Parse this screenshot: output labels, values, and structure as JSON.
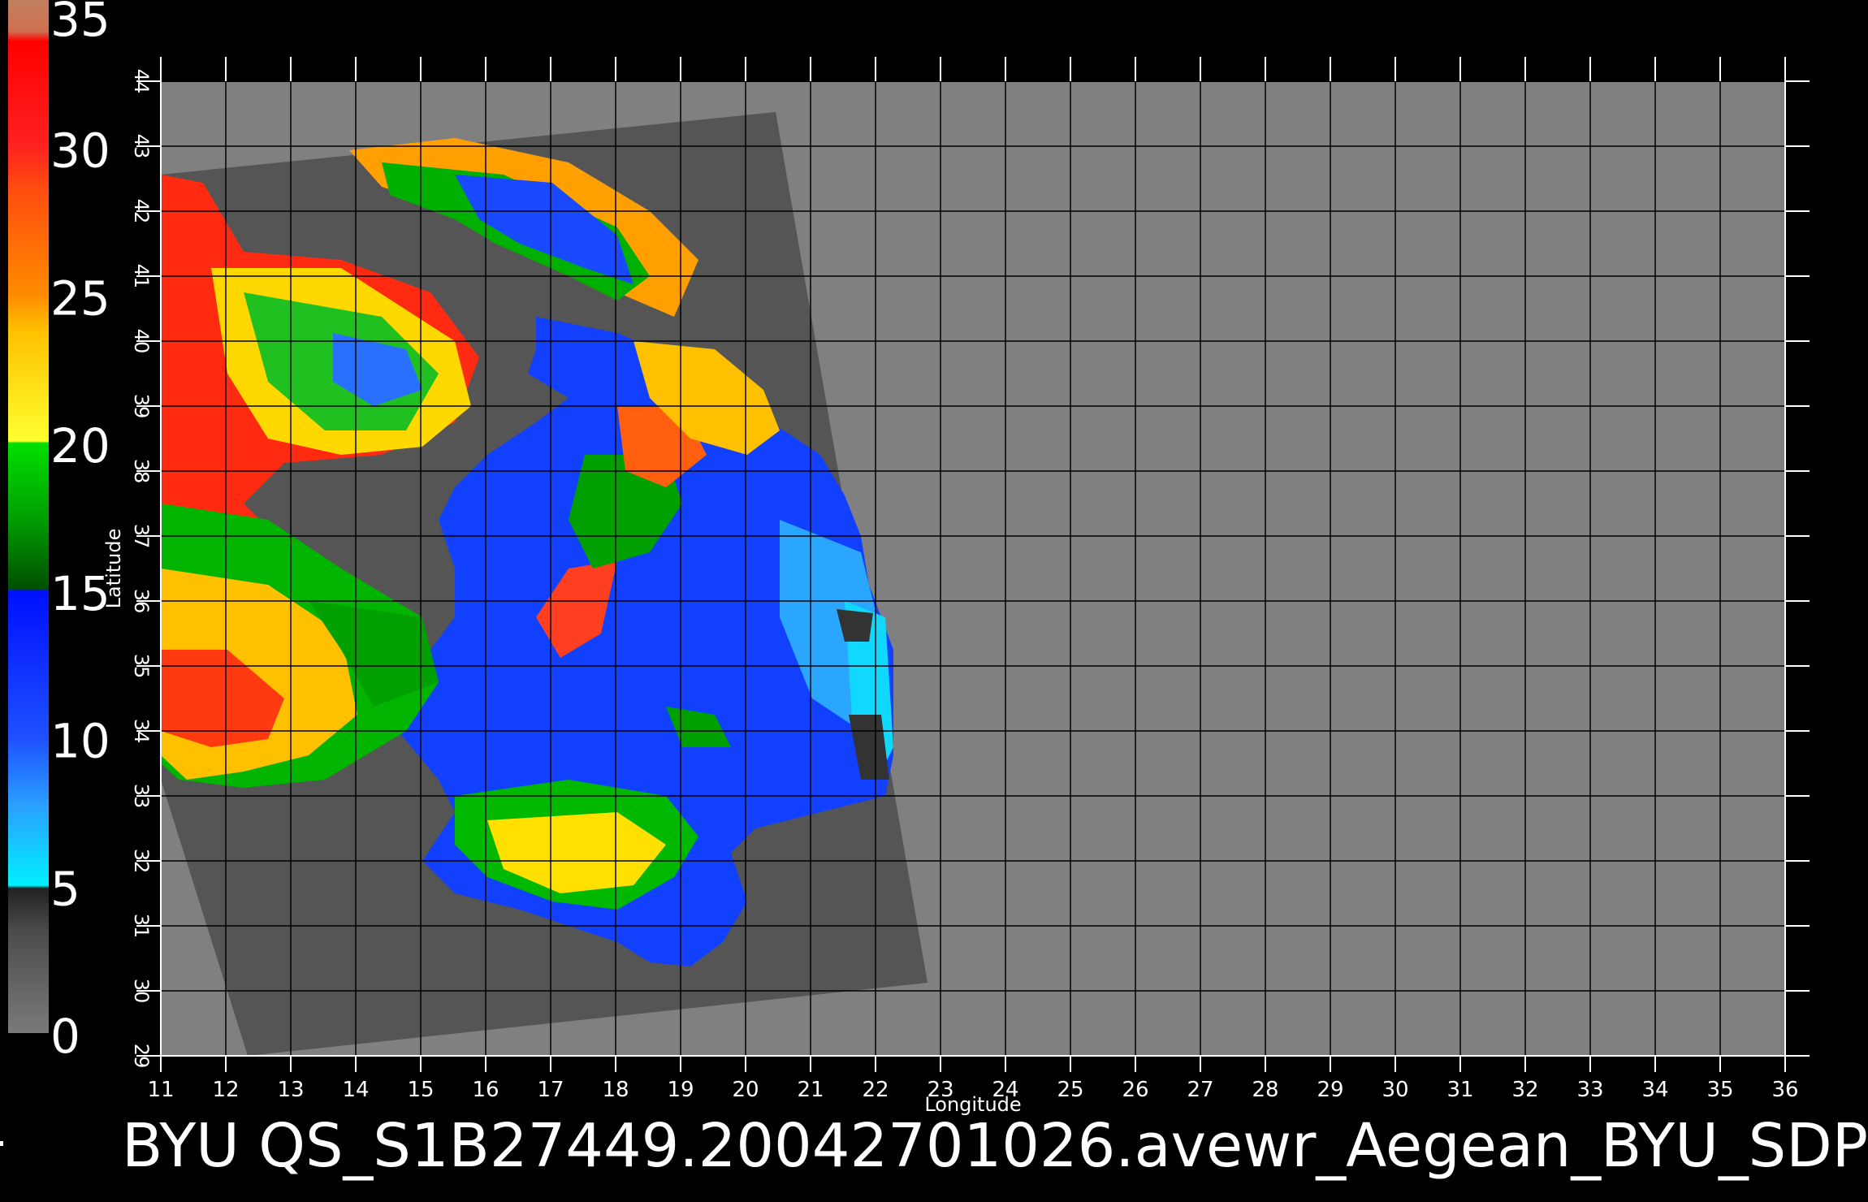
{
  "title": "BYU  QS_S1B27449.20042701026.avewr_Aegean_BYU_SDP",
  "map": {
    "x_axis_label": "Longitude",
    "y_axis_label": "Latitude",
    "lon_ticks": [
      "11",
      "12",
      "13",
      "14",
      "15",
      "16",
      "17",
      "18",
      "19",
      "20",
      "21",
      "22",
      "23",
      "24",
      "25",
      "26",
      "27",
      "28",
      "29",
      "30",
      "31",
      "32",
      "33",
      "34",
      "35",
      "36"
    ],
    "lat_ticks": [
      "29",
      "30",
      "31",
      "32",
      "33",
      "34",
      "35",
      "36",
      "37",
      "38",
      "39",
      "40",
      "41",
      "42",
      "43",
      "44"
    ],
    "lon_range": [
      11,
      36
    ],
    "lat_range": [
      29,
      44
    ],
    "background_color": "#808080",
    "swath_color": "#555555"
  },
  "colorbar": {
    "labels": [
      "0",
      "5",
      "10",
      "15",
      "20",
      "25",
      "30",
      "35"
    ],
    "colors": [
      "#6a6a6a",
      "#3a3a3a",
      "#00e5ff",
      "#1e6aff",
      "#0a2aff",
      "#006400",
      "#00c800",
      "#ffff00",
      "#ffa500",
      "#ff5a00",
      "#ff0000",
      "#c08060"
    ]
  }
}
